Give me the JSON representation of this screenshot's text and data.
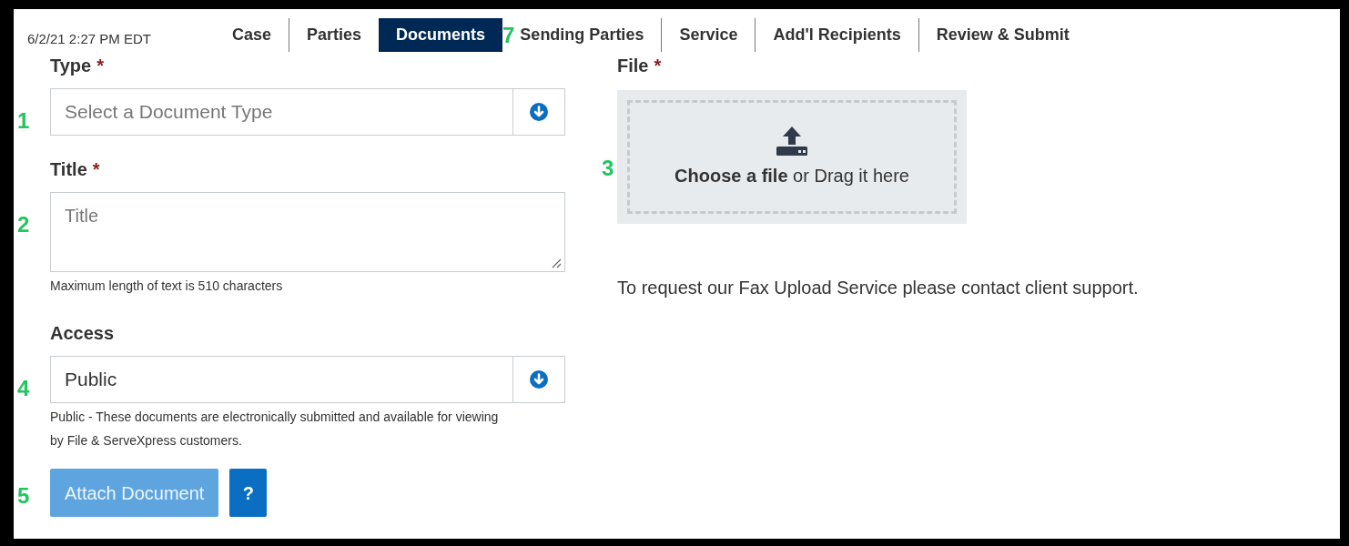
{
  "timestamp": "6/2/21 2:27 PM EDT",
  "tabs": [
    {
      "label": "Case",
      "selected": false
    },
    {
      "label": "Parties",
      "selected": false
    },
    {
      "label": "Documents",
      "selected": true
    },
    {
      "label": "Sending Parties",
      "selected": false,
      "callout": "7"
    },
    {
      "label": "Service",
      "selected": false
    },
    {
      "label": "Add'l Recipients",
      "selected": false
    },
    {
      "label": "Review & Submit",
      "selected": false
    }
  ],
  "fields": [
    {
      "kind": "select",
      "label": "Type",
      "required_mark": "*",
      "placeholder": "Select a Document Type",
      "callout": "1"
    },
    {
      "kind": "textarea",
      "label": "Title",
      "required_mark": "*",
      "placeholder": "Title",
      "help": "Maximum length of text is 510 characters",
      "callout": "2"
    },
    {
      "kind": "select",
      "label": "Access",
      "value": "Public",
      "help": "Public - These documents are electronically submitted and available for viewing by File & ServeXpress customers.",
      "callout": "4"
    }
  ],
  "buttons": [
    {
      "kind": "primary",
      "label": "Attach Document",
      "disabled": true,
      "callout": "5"
    },
    {
      "kind": "help",
      "label": "?",
      "disabled": false
    }
  ],
  "file": {
    "label": "File",
    "required_mark": "*",
    "prompt": "**Choose a file** or Drag it here",
    "callout": "3"
  },
  "fax_note": "To request our Fax Upload Service please contact client support."
}
